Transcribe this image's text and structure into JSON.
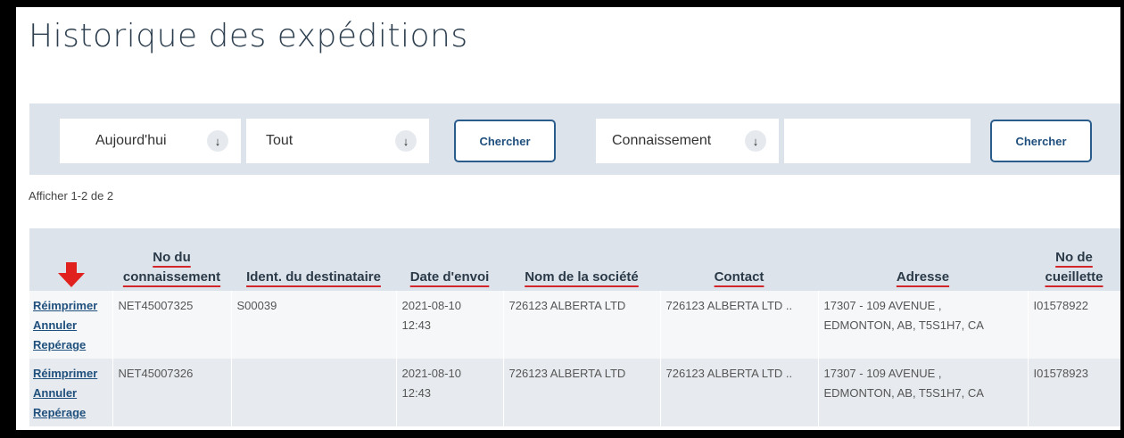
{
  "page": {
    "title": "Historique des expéditions"
  },
  "filters": {
    "date_select": "Aujourd'hui",
    "status_select": "Tout",
    "search_button_1": "Chercher",
    "type_select": "Connaissement",
    "search_value": "",
    "search_button_2": "Chercher",
    "arrow_icon": "arrow-down-icon"
  },
  "results": {
    "count_text": "Afficher 1-2 de 2"
  },
  "table": {
    "columns": [
      "",
      "No du connaissement",
      "Ident. du destinataire",
      "Date d'envoi",
      "Nom de la société",
      "Contact",
      "Adresse",
      "No de cueillette"
    ],
    "accent_color": "#d2262b",
    "rows": [
      {
        "actions": [
          "Réimprimer",
          "Annuler",
          "Repérage"
        ],
        "bol": "NET45007325",
        "recipient_id": "S00039",
        "date_line1": "2021-08-10",
        "date_line2": "12:43",
        "company": "726123 ALBERTA LTD",
        "contact": "726123 ALBERTA LTD ..",
        "address_line1": "17307 - 109 AVENUE ,",
        "address_line2": "EDMONTON, AB, T5S1H7, CA",
        "pickup": "I01578922"
      },
      {
        "actions": [
          "Réimprimer",
          "Annuler",
          "Repérage"
        ],
        "bol": "NET45007326",
        "recipient_id": "",
        "date_line1": "2021-08-10",
        "date_line2": "12:43",
        "company": "726123 ALBERTA LTD",
        "contact": "726123 ALBERTA LTD ..",
        "address_line1": "17307 - 109 AVENUE ,",
        "address_line2": "EDMONTON, AB, T5S1H7, CA",
        "pickup": "I01578923"
      }
    ]
  }
}
